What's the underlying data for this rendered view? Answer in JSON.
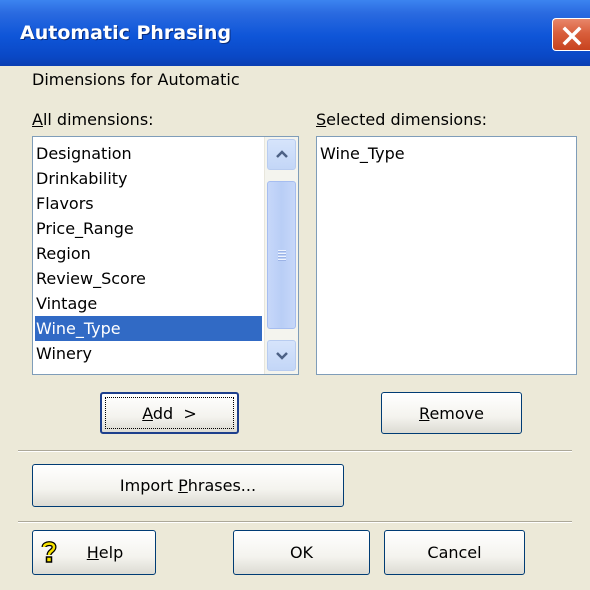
{
  "window": {
    "title": "Automatic Phrasing",
    "close_icon": "close-x-icon"
  },
  "heading": "Dimensions for Automatic",
  "all_dimensions": {
    "label_mnemonic": "A",
    "label_rest": "ll dimensions:",
    "items": [
      "Designation",
      "Drinkability",
      "Flavors",
      "Price_Range",
      "Region",
      "Review_Score",
      "Vintage",
      "Wine_Type",
      "Winery"
    ],
    "selected_item": "Wine_Type"
  },
  "selected_dimensions": {
    "label_mnemonic": "S",
    "label_rest": "elected dimensions:",
    "items": [
      "Wine_Type"
    ]
  },
  "buttons": {
    "add": {
      "mnemonic": "A",
      "rest": "dd  >"
    },
    "remove": {
      "mnemonic": "R",
      "rest": "emove"
    },
    "import": {
      "pre": "Import ",
      "mnemonic": "P",
      "rest": "hrases..."
    },
    "help": {
      "mnemonic": "H",
      "rest": "elp",
      "icon": "question-mark-icon"
    },
    "ok": "OK",
    "cancel": "Cancel"
  }
}
